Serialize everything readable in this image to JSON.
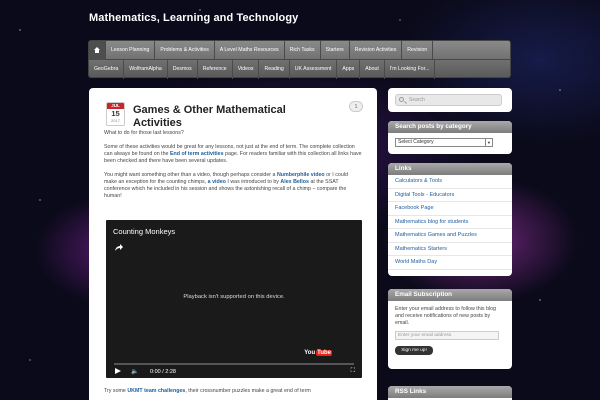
{
  "site": {
    "title": "Mathematics, Learning and Technology"
  },
  "nav": {
    "home_icon": "home-icon",
    "row1": [
      "Lesson Planning",
      "Problems & Activities",
      "A Level Maths Resources",
      "Rich Tasks",
      "Starters",
      "Revision Activities",
      "Revision"
    ],
    "row2": [
      "GeoGebra",
      "WolframAlpha",
      "Desmos",
      "Reference",
      "Videos",
      "Reading",
      "UK Assessment",
      "Apps",
      "About",
      "I'm Looking For..."
    ]
  },
  "post": {
    "date": {
      "month": "JUL",
      "day": "15",
      "year": "2017"
    },
    "comment_count": "1",
    "title": "Games & Other Mathematical Activities",
    "p1": "What to do for those last lessons?",
    "p2a": "Some of these activities would be great for any lessons, not just at the end of term. The complete collection can always be found on the ",
    "p2_link": "End of term activities",
    "p2b": " page. For readers familiar with this collection all links have been checked and there have been several updates.",
    "p3a": "You might want something other than a video, though perhaps consider a ",
    "p3_link1": "Numberphile video",
    "p3b": " or I could make an exception for the counting chimps, ",
    "p3_link2": "a video",
    "p3c": " I was introduced to by ",
    "p3_link3": "Alex Bellos",
    "p3d": " at the SSAT conference which he included in his session and shows the astonishing recall of a chimp – compare the human!",
    "p4a": "Try some ",
    "p4_link": "UKMT team challenges",
    "p4b": ", their crossnumber puzzles make a great end of term"
  },
  "video": {
    "title": "Counting Monkeys",
    "message": "Playback isn't supported on this device.",
    "time": "0:00 / 2:28",
    "logo_text": "You",
    "logo_tube": "Tube"
  },
  "sidebar": {
    "search_placeholder": "Search",
    "category_heading": "Search posts by category",
    "category_select": "Select Category",
    "links_heading": "Links",
    "links": [
      "Calculators & Tools",
      "Digital Tools - Educators",
      "Facebook Page",
      "Mathematics blog for students",
      "Mathematics Games and Puzzles",
      "Mathematics Starters",
      "World Maths Day"
    ],
    "email_heading": "Email Subscription",
    "email_text": "Enter your email address to follow this blog and receive notifications of new posts by email.",
    "email_placeholder": "Enter your email address",
    "signup_label": "Sign me up!",
    "rss_heading": "RSS Links"
  }
}
